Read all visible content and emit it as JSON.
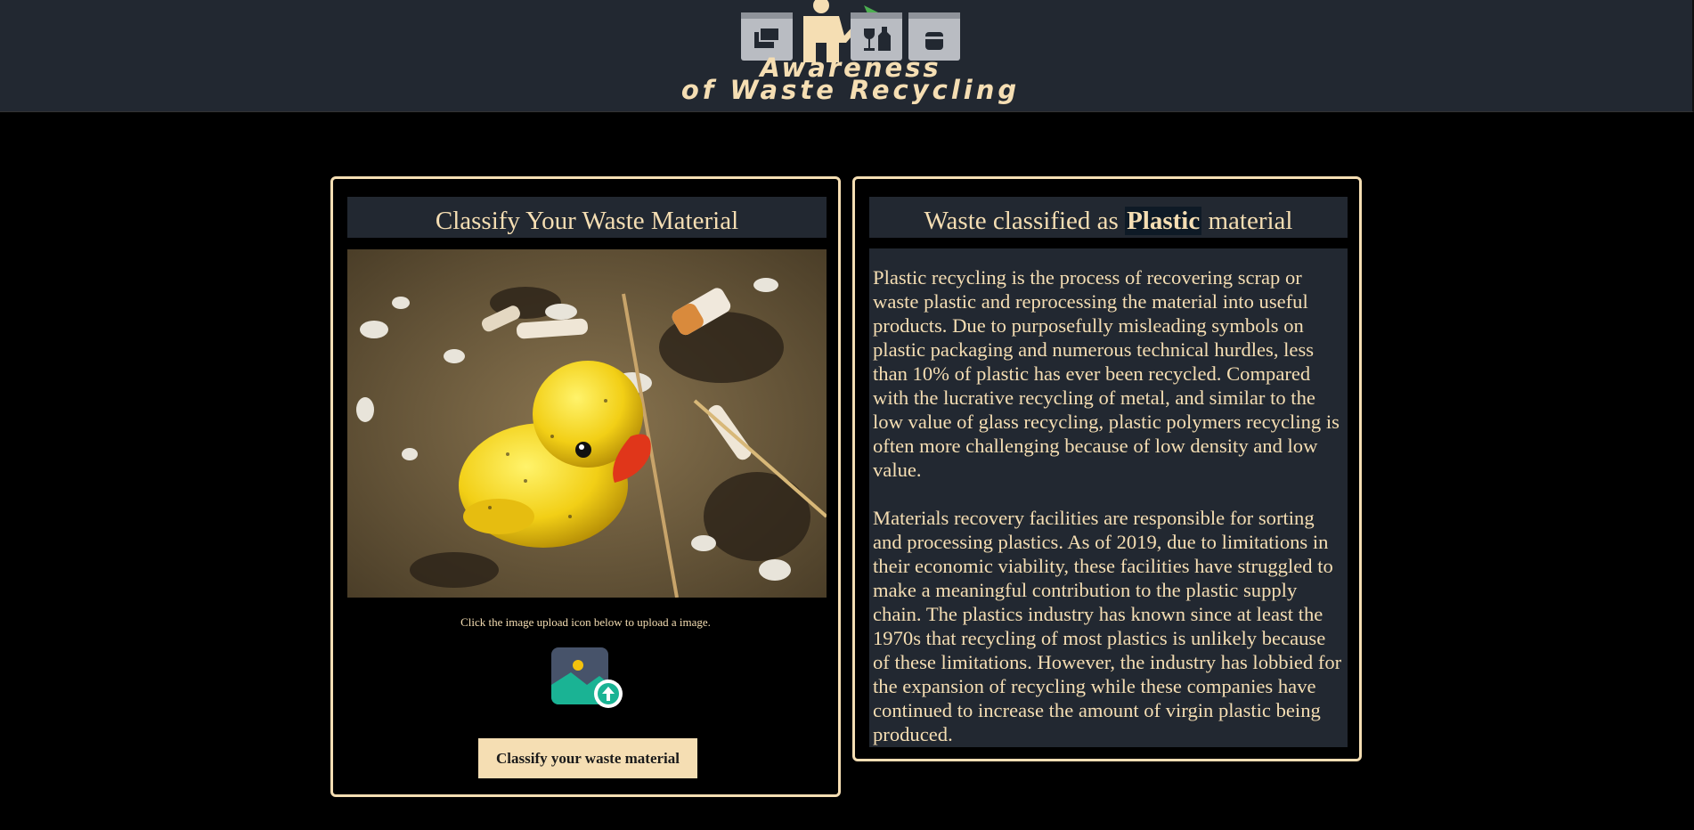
{
  "header": {
    "logo_line1": "Awareness",
    "logo_line2": "of Waste Recycling"
  },
  "classifier": {
    "title": "Classify Your Waste Material",
    "image_alt": "rubber duck on sandy beach with plastic litter",
    "hint": "Click the image upload icon below to upload a image.",
    "upload_icon": "image-upload-icon",
    "button_label": "Classify your waste material"
  },
  "result": {
    "title_prefix": "Waste classified as ",
    "material": "Plastic",
    "title_suffix": " material",
    "paragraphs": [
      "Plastic recycling is the process of recovering scrap or waste plastic and reprocessing the material into useful products. Due to purposefully misleading symbols on plastic packaging and numerous technical hurdles, less than 10% of plastic has ever been recycled. Compared with the lucrative recycling of metal, and similar to the low value of glass recycling, plastic polymers recycling is often more challenging because of low density and low value.",
      "Materials recovery facilities are responsible for sorting and processing plastics. As of 2019, due to limitations in their economic viability, these facilities have struggled to make a meaningful contribution to the plastic supply chain. The plastics industry has known since at least the 1970s that recycling of most plastics is unlikely because of these limitations. However, the industry has lobbied for the expansion of recycling while these companies have continued to increase the amount of virgin plastic being produced."
    ]
  },
  "colors": {
    "accent": "#f5deb3",
    "panel": "#222831",
    "background": "#000000"
  }
}
